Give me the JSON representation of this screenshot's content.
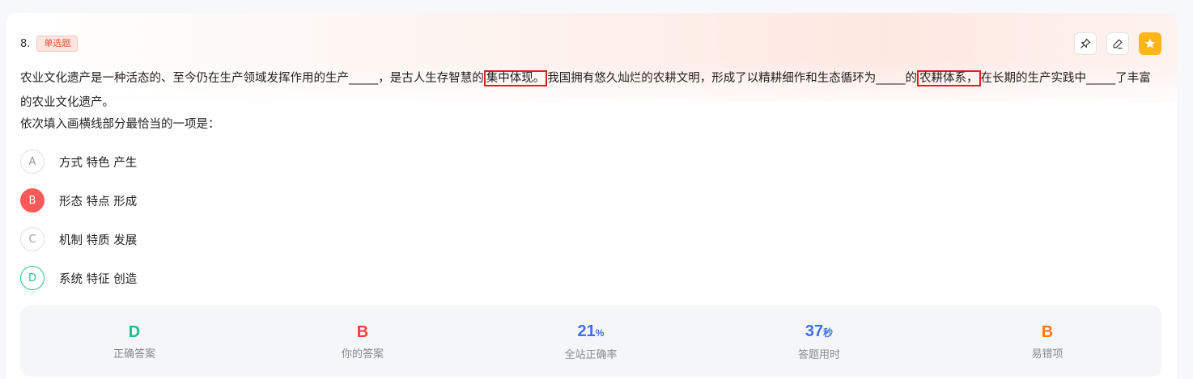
{
  "question": {
    "number": "8.",
    "type_tag": "单选题",
    "stem_parts": [
      "农业文化遗产是一种活态的、至今仍在生产领域发挥作用的生产_____，是古人生存智慧的",
      "集中体现。",
      "我国拥有悠久灿烂的农耕文明，形成了以精耕细作和生态循环为_____的",
      "农耕体系，",
      "在长期的生产实践中_____了丰富的农业文化遗产。"
    ],
    "prompt": "依次填入画横线部分最恰当的一项是："
  },
  "actions": [
    {
      "icon": "pin-icon"
    },
    {
      "icon": "edit-icon"
    },
    {
      "icon": "star-icon",
      "color": "#ffb619"
    }
  ],
  "options": [
    {
      "letter": "A",
      "text": "方式 特色 产生",
      "state": "normal"
    },
    {
      "letter": "B",
      "text": "形态 特点 形成",
      "state": "wrong"
    },
    {
      "letter": "C",
      "text": "机制 特质 发展",
      "state": "normal"
    },
    {
      "letter": "D",
      "text": "系统 特征 创造",
      "state": "correct"
    }
  ],
  "stats": {
    "correct_answer": {
      "value": "D",
      "label": "正确答案",
      "color": "#19c08a"
    },
    "your_answer": {
      "value": "B",
      "label": "你的答案",
      "color": "#f5413c"
    },
    "accuracy": {
      "value": "21",
      "unit": "%",
      "label": "全站正确率",
      "color": "#3d6ff0"
    },
    "time_used": {
      "value": "37",
      "unit": "秒",
      "label": "答题用时",
      "color": "#3d6ff0"
    },
    "common_wrong": {
      "value": "B",
      "label": "易错项",
      "color": "#ff7a1a"
    }
  },
  "colors": {
    "highlight_box": "#e02020",
    "wrong": "#ff5a5a",
    "correct": "#2cc38d"
  }
}
